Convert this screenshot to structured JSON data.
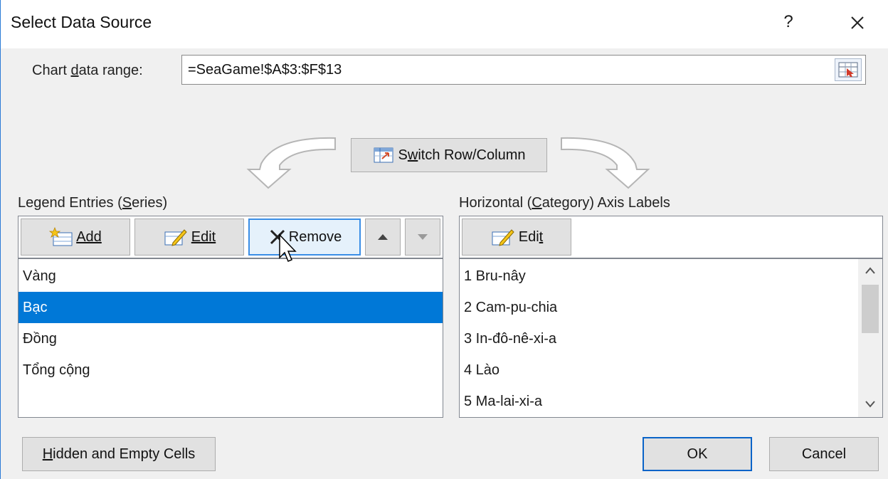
{
  "window": {
    "title": "Select Data Source",
    "help_label": "?"
  },
  "data_range": {
    "label_pre": "Chart ",
    "label_accel": "d",
    "label_post": "ata range:",
    "value": "=SeaGame!$A$3:$F$13"
  },
  "switch_button": {
    "label_pre": "S",
    "label_accel": "w",
    "label_post": "itch Row/Column"
  },
  "legend": {
    "heading_pre": "Legend Entries (",
    "heading_accel": "S",
    "heading_post": "eries)",
    "add_label": "Add",
    "edit_label": "Edit",
    "remove_label": "Remove",
    "items": [
      {
        "label": "Vàng",
        "selected": false
      },
      {
        "label": "Bạc",
        "selected": true
      },
      {
        "label": "Đồng",
        "selected": false
      },
      {
        "label": "Tổng cộng",
        "selected": false
      }
    ]
  },
  "axis": {
    "heading_pre": "Horizontal (",
    "heading_accel": "C",
    "heading_post": "ategory) Axis Labels",
    "edit_label_pre": "Edi",
    "edit_label_accel": "t",
    "items": [
      {
        "label": "1 Bru-nây"
      },
      {
        "label": "2 Cam-pu-chia"
      },
      {
        "label": "3 In-đô-nê-xi-a"
      },
      {
        "label": "4 Lào"
      },
      {
        "label": "5 Ma-lai-xi-a"
      }
    ]
  },
  "footer": {
    "hidden_cells_accel": "H",
    "hidden_cells_post": "idden and Empty Cells",
    "ok_label": "OK",
    "cancel_label": "Cancel"
  },
  "colors": {
    "selection": "#0078d7",
    "focus_border": "#0a64c8",
    "hover_border": "#3a8ee6"
  }
}
